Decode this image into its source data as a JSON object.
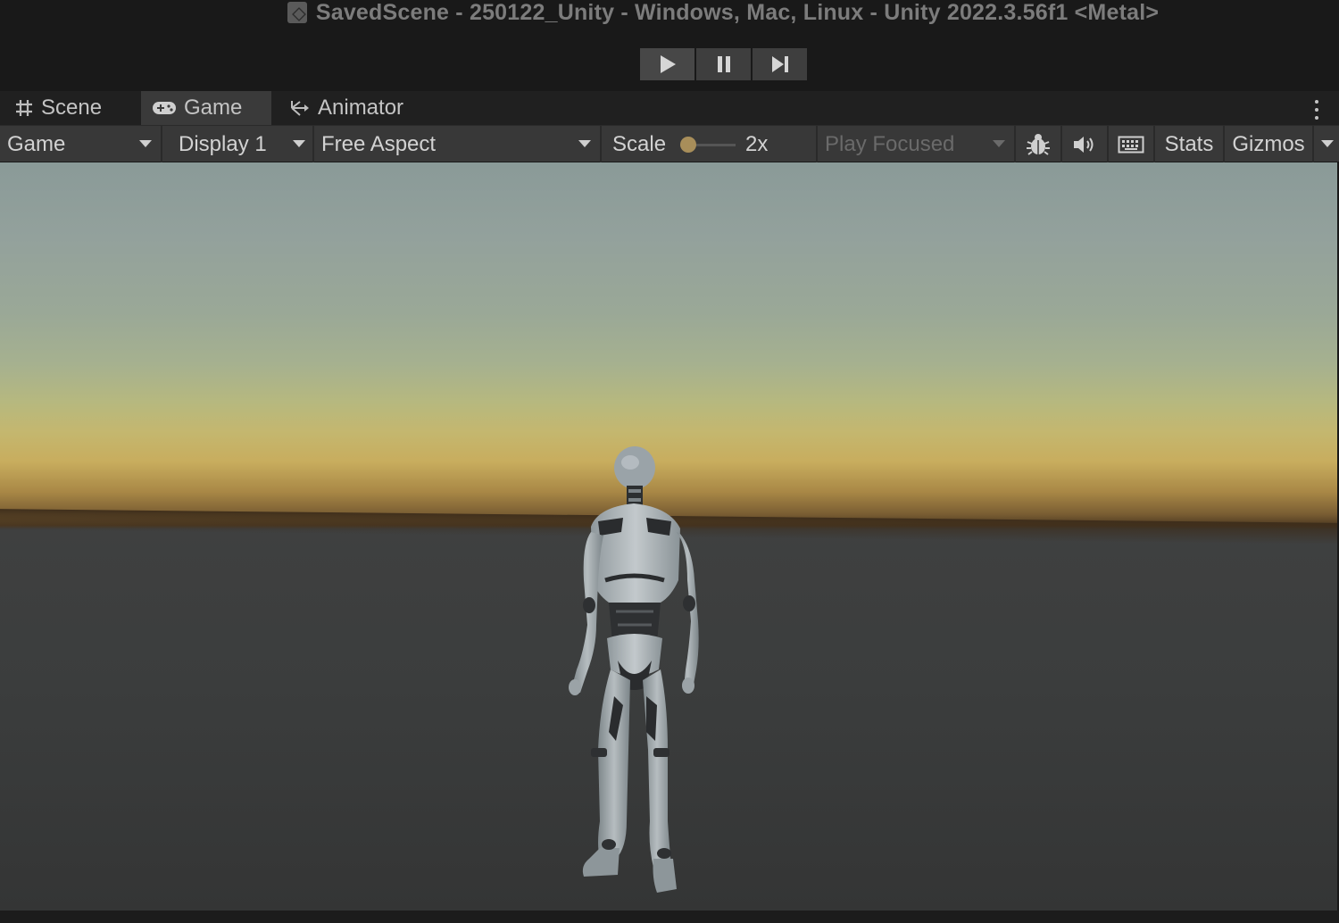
{
  "window": {
    "title": "SavedScene - 250122_Unity - Windows, Mac, Linux - Unity 2022.3.56f1 <Metal>"
  },
  "play_controls": {
    "buttons": [
      {
        "name": "play",
        "icon": "play-icon"
      },
      {
        "name": "pause",
        "icon": "pause-icon"
      },
      {
        "name": "step",
        "icon": "step-icon"
      }
    ]
  },
  "tabs": [
    {
      "label": "Scene",
      "icon": "scene-grid-icon",
      "active": false
    },
    {
      "label": "Game",
      "icon": "gamepad-icon",
      "active": true
    },
    {
      "label": "Animator",
      "icon": "animator-icon",
      "active": false
    }
  ],
  "toolbar": {
    "view_mode": "Game",
    "display": "Display 1",
    "aspect": "Free Aspect",
    "scale_label": "Scale",
    "scale_value": "2x",
    "scale_level": 0,
    "play_focused": "Play Focused",
    "stats": "Stats",
    "gizmos": "Gizmos",
    "icons": [
      "bug-icon",
      "audio-icon",
      "keyboard-icon"
    ]
  },
  "colors": {
    "accent_slider_thumb": "#a88e5a",
    "toolbar_bg": "#383838",
    "tab_active_bg": "#3a3a3a",
    "window_bg": "#191919"
  }
}
